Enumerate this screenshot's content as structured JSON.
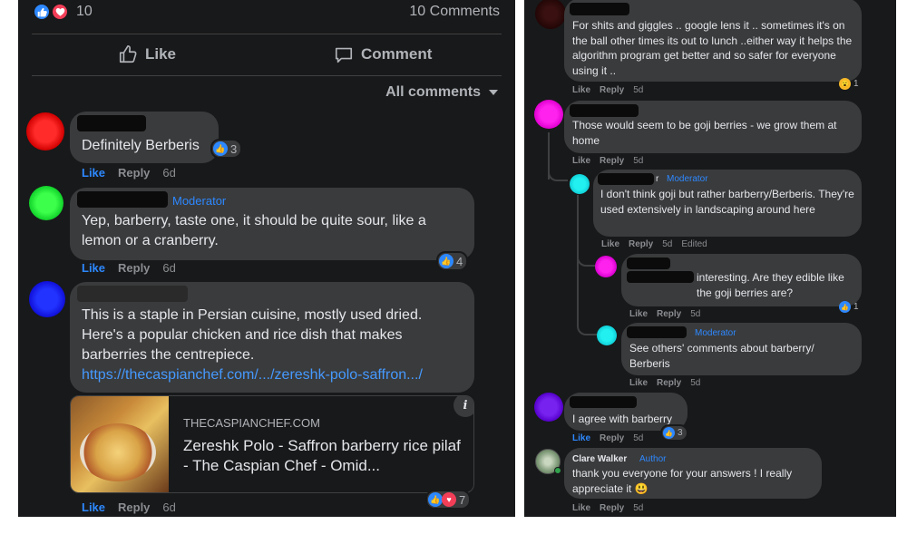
{
  "left": {
    "reaction_count": "10",
    "comments_count": "10 Comments",
    "like_label": "Like",
    "comment_label": "Comment",
    "filter_label": "All comments",
    "comments": [
      {
        "text": "Definitely Berberis",
        "reactions": "3",
        "like": "Like",
        "reply": "Reply",
        "time": "6d"
      },
      {
        "badge": "Moderator",
        "text": "Yep, barberry, taste one, it should be quite sour, like a lemon or a cranberry.",
        "reactions": "4",
        "like": "Like",
        "reply": "Reply",
        "time": "6d"
      },
      {
        "text": "This is a staple in Persian cuisine, mostly used dried. Here's a popular chicken and rice dish that makes barberries the centrepiece.",
        "link": "https://thecaspianchef.com/.../zereshk-polo-saffron.../",
        "reactions": "7",
        "like": "Like",
        "reply": "Reply",
        "time": "6d"
      }
    ],
    "link_card": {
      "domain": "THECASPIANCHEF.COM",
      "title": "Zereshk Polo - Saffron barberry rice pilaf - The Caspian Chef - Omid..."
    }
  },
  "right": {
    "comments": [
      {
        "text": "For shits and giggles .. google lens it .. sometimes it's on the ball other times its out to lunch ..either way it helps the algorithm program get better and so safer for everyone using it ..",
        "reactions": "1",
        "like": "Like",
        "reply": "Reply",
        "time": "5d"
      },
      {
        "text": "Those would seem to be goji berries - we grow them at home",
        "like": "Like",
        "reply": "Reply",
        "time": "5d"
      },
      {
        "name_suffix": "r",
        "badge": "Moderator",
        "text": "I don't think goji but rather barberry/Berberis. They're used extensively in landscaping around here",
        "like": "Like",
        "reply": "Reply",
        "time": "5d",
        "edited": "Edited"
      },
      {
        "text": "interesting. Are they edible like the goji berries are?",
        "reactions": "1",
        "like": "Like",
        "reply": "Reply",
        "time": "5d"
      },
      {
        "badge": "Moderator",
        "text": "See others' comments about barberry/ Berberis",
        "like": "Like",
        "reply": "Reply",
        "time": "5d"
      },
      {
        "text": "I agree with barberry",
        "reactions": "3",
        "like": "Like",
        "reply": "Reply",
        "time": "5d"
      },
      {
        "name": "Clare Walker",
        "badge": "Author",
        "text": "thank you everyone for your answers ! I really appreciate it 😃",
        "like": "Like",
        "reply": "Reply",
        "time": "5d"
      }
    ]
  },
  "colors": {
    "panel_bg": "#18191a",
    "bubble_bg": "#3a3b3c",
    "text": "#e4e6eb",
    "muted": "#b0b3b8",
    "accent_blue": "#2d88ff",
    "love_red": "#f33e58"
  }
}
